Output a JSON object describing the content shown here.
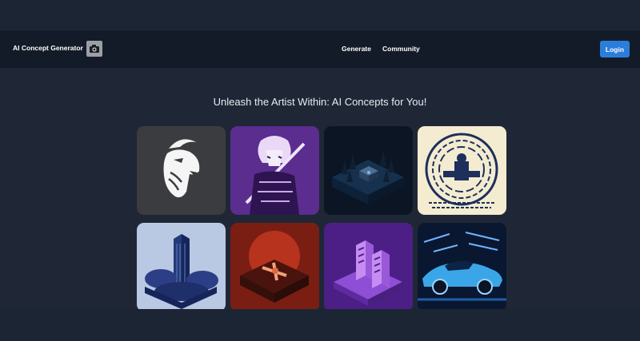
{
  "header": {
    "brand": "AI Concept Generator",
    "logo_icon": "camera-icon",
    "nav": [
      {
        "label": "Generate"
      },
      {
        "label": "Community"
      }
    ],
    "login_label": "Login",
    "accent_color": "#2b7ddb"
  },
  "main": {
    "heading": "Unleash the Artist Within: AI Concepts for You!",
    "gallery": [
      {
        "subject": "goat-head-logo"
      },
      {
        "subject": "anime-swordsman"
      },
      {
        "subject": "isometric-forest-house"
      },
      {
        "subject": "circuit-maze-figure"
      },
      {
        "subject": "isometric-skyscraper-clouds"
      },
      {
        "subject": "isometric-red-planet-aircraft"
      },
      {
        "subject": "isometric-server-racks"
      },
      {
        "subject": "futuristic-sports-car"
      }
    ]
  }
}
